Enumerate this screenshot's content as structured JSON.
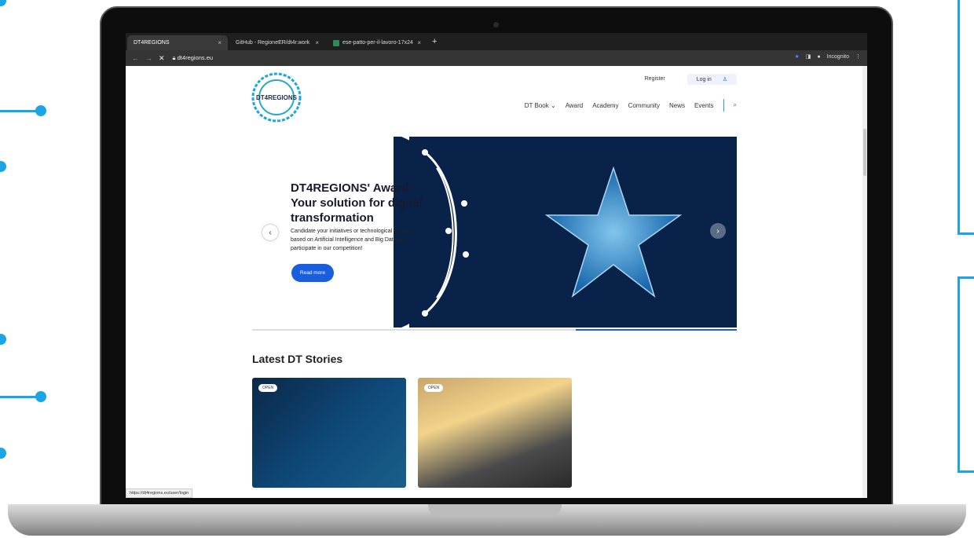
{
  "browser": {
    "tabs": [
      {
        "label": "DT4REGIONS",
        "close": "×"
      },
      {
        "label": "GitHub - RegioneER/dt4r.work",
        "close": "×"
      },
      {
        "label": "ese-patto-per-il-lavoro-17x24",
        "close": "×"
      }
    ],
    "new_tab": "+",
    "back": "←",
    "forward": "→",
    "stop": "✕",
    "url": "dt4regions.eu",
    "profile": "Incognito",
    "status_url": "https://dt4regions.eu/user/login"
  },
  "site": {
    "top_links": {
      "register": "Register",
      "login": "Log in"
    },
    "nav": [
      "DT Book",
      "Award",
      "Academy",
      "Community",
      "News",
      "Events"
    ],
    "hero": {
      "title": "DT4REGIONS' Award: Your solution for digital transformation",
      "text": "Candidate your initiatives or technological solutions based on Artificial Intelligence and Big Data and participate in our competition!",
      "button": "Read more",
      "prev": "‹",
      "next": "›"
    },
    "section_title": "Latest DT Stories",
    "cards": [
      {
        "badge": "OPEN"
      },
      {
        "badge": "OPEN"
      }
    ],
    "logo_text": "DT4REGIONS"
  },
  "colors": {
    "accent": "#1aa6e6",
    "button": "#1a5ee0",
    "hero_bg": "#08224a"
  }
}
